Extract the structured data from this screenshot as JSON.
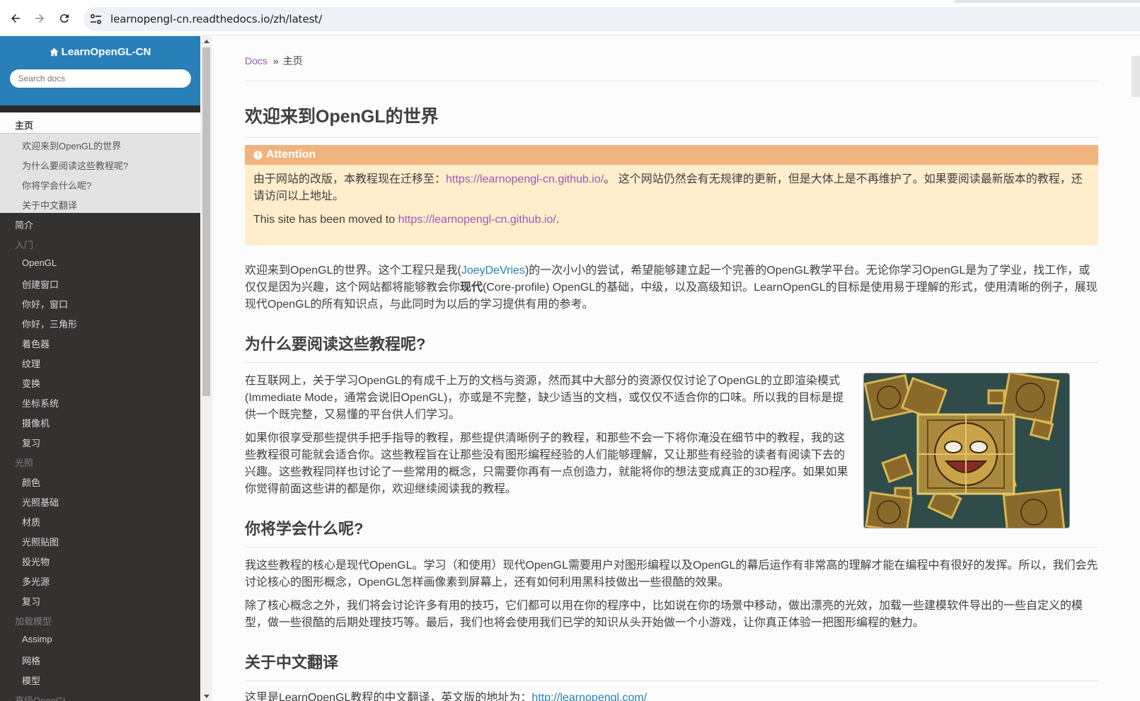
{
  "browser": {
    "url": "learnopengl-cn.readthedocs.io/zh/latest/",
    "back_icon": "arrow-left-icon",
    "forward_icon": "arrow-right-icon",
    "reload_icon": "reload-icon",
    "site_info_icon": "tune-icon"
  },
  "sidebar": {
    "project_name": "LearnOpenGL-CN",
    "home_icon": "home-icon",
    "search_placeholder": "Search docs",
    "current": "主页",
    "current_subitems": [
      "欢迎来到OpenGL的世界",
      "为什么要阅读这些教程呢?",
      "你将学会什么呢?",
      "关于中文翻译"
    ],
    "items": [
      {
        "label": "简介",
        "kind": "top"
      },
      {
        "label": "入门",
        "kind": "caption"
      },
      {
        "label": "OpenGL",
        "kind": "child"
      },
      {
        "label": "创建窗口",
        "kind": "child"
      },
      {
        "label": "你好，窗口",
        "kind": "child"
      },
      {
        "label": "你好，三角形",
        "kind": "child"
      },
      {
        "label": "着色器",
        "kind": "child"
      },
      {
        "label": "纹理",
        "kind": "child"
      },
      {
        "label": "变换",
        "kind": "child"
      },
      {
        "label": "坐标系统",
        "kind": "child"
      },
      {
        "label": "摄像机",
        "kind": "child"
      },
      {
        "label": "复习",
        "kind": "child"
      },
      {
        "label": "光照",
        "kind": "caption"
      },
      {
        "label": "颜色",
        "kind": "child"
      },
      {
        "label": "光照基础",
        "kind": "child"
      },
      {
        "label": "材质",
        "kind": "child"
      },
      {
        "label": "光照贴图",
        "kind": "child"
      },
      {
        "label": "投光物",
        "kind": "child"
      },
      {
        "label": "多光源",
        "kind": "child"
      },
      {
        "label": "复习",
        "kind": "child"
      },
      {
        "label": "加载模型",
        "kind": "caption"
      },
      {
        "label": "Assimp",
        "kind": "child"
      },
      {
        "label": "网格",
        "kind": "child"
      },
      {
        "label": "模型",
        "kind": "child"
      },
      {
        "label": "高级OpenGL",
        "kind": "caption"
      }
    ]
  },
  "breadcrumb": {
    "docs": "Docs",
    "separator": "»",
    "current": "主页"
  },
  "page": {
    "title": "欢迎来到OpenGL的世界",
    "attention": {
      "title": "Attention",
      "icon": "exclamation-circle-icon",
      "line1_prefix": "由于网站的改版，本教程现在迁移至：",
      "line1_link": "https://learnopengl-cn.github.io/",
      "line1_suffix": "。 这个网站仍然会有无规律的更新，但是大体上是不再维护了。如果要阅读最新版本的教程，还请访问以上地址。",
      "line2_prefix": "This site has been moved to ",
      "line2_link": "https://learnopengl-cn.github.io/",
      "line2_suffix": "."
    },
    "intro": {
      "part1": "欢迎来到OpenGL的世界。这个工程只是我(",
      "link": "JoeyDeVries",
      "part2": ")的一次小小的尝试，希望能够建立起一个完善的OpenGL教学平台。无论你学习OpenGL是为了学业，找工作，或仅仅是因为兴趣，这个网站都将能够教会你",
      "bold": "现代",
      "part3": "(Core-profile) OpenGL的基础，中级，以及高级知识。LearnOpenGL的目标是使用易于理解的形式，使用清晰的例子，展现现代OpenGL的所有知识点，与此同时为以后的学习提供有用的参考。"
    },
    "why": {
      "heading": "为什么要阅读这些教程呢?",
      "p1": "在互联网上，关于学习OpenGL的有成千上万的文档与资源，然而其中大部分的资源仅仅讨论了OpenGL的立即渲染模式(Immediate Mode，通常会说旧OpenGL)，亦或是不完整，缺少适当的文档，或仅仅不适合你的口味。所以我的目标是提供一个既完整，又易懂的平台供人们学习。",
      "p2": "如果你很享受那些提供手把手指导的教程，那些提供清晰例子的教程，和那些不会一下将你淹没在细节中的教程，我的这些教程很可能就会适合你。这些教程旨在让那些没有图形编程经验的人们能够理解，又让那些有经验的读者有阅读下去的兴趣。这些教程同样也讨论了一些常用的概念，只需要你再有一点创造力，就能将你的想法变成真正的3D程序。如果如果你觉得前面这些讲的都是你，欢迎继续阅读我的教程。"
    },
    "learn": {
      "heading": "你将学会什么呢?",
      "p1": "我这些教程的核心是现代OpenGL。学习（和使用）现代OpenGL需要用户对图形编程以及OpenGL的幕后运作有非常高的理解才能在编程中有很好的发挥。所以，我们会先讨论核心的图形概念，OpenGL怎样画像素到屏幕上，还有如何利用黑科技做出一些很酷的效果。",
      "p2": "除了核心概念之外，我们将会讨论许多有用的技巧，它们都可以用在你的程序中，比如说在你的场景中移动，做出漂亮的光效，加载一些建模软件导出的一些自定义的模型，做一些很酷的后期处理技巧等。最后，我们也将会使用我们已学的知识从头开始做一个小游戏，让你真正体验一把图形编程的魅力。"
    },
    "translation": {
      "heading": "关于中文翻译",
      "text": "这里是LearnOpenGL教程的中文翻译，英文版的地址为：",
      "link": "http://learnopengl.com/"
    }
  },
  "colors": {
    "sidebar_bg": "#343131",
    "sidebar_head": "#2980b9",
    "link_purple": "#9b59b6",
    "link_blue": "#2980b9",
    "attention_title": "#f0b37e",
    "attention_bg": "#ffedcc"
  }
}
